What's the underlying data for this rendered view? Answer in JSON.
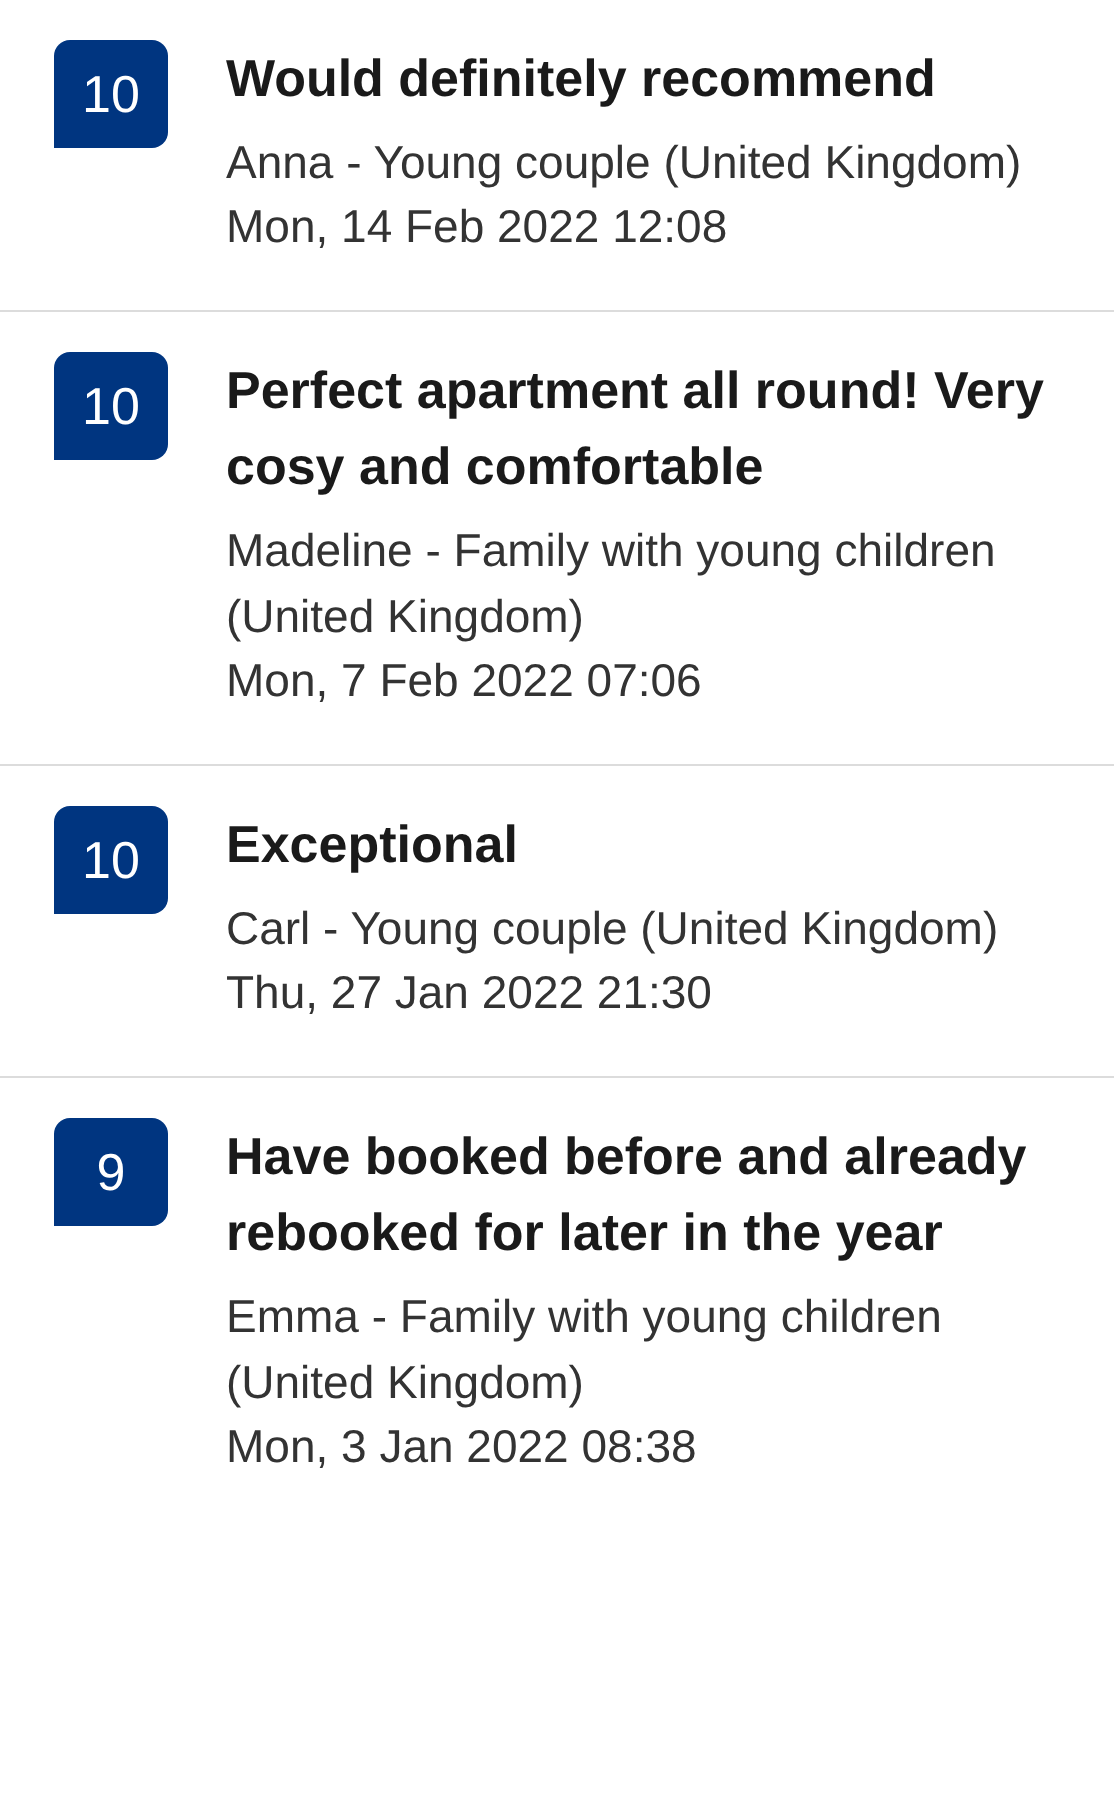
{
  "reviews": [
    {
      "score": "10",
      "title": "Would definitely recommend",
      "reviewer": "Anna - Young couple (United Kingdom)",
      "date": "Mon, 14 Feb 2022 12:08"
    },
    {
      "score": "10",
      "title": "Perfect apartment all round! Very cosy and comfortable",
      "reviewer": "Madeline - Family with young children (United Kingdom)",
      "date": "Mon, 7 Feb 2022 07:06"
    },
    {
      "score": "10",
      "title": "Exceptional",
      "reviewer": "Carl - Young couple (United Kingdom)",
      "date": "Thu, 27 Jan 2022 21:30"
    },
    {
      "score": "9",
      "title": "Have booked before and already rebooked for later in the year",
      "reviewer": "Emma - Family with young children (United Kingdom)",
      "date": "Mon, 3 Jan 2022 08:38"
    }
  ]
}
